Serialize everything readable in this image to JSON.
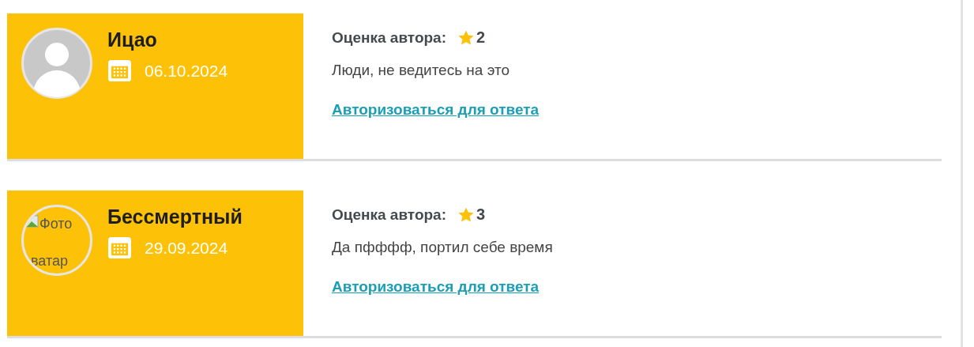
{
  "reviews": [
    {
      "author": "Ицао",
      "date": "06.10.2024",
      "avatar": {
        "kind": "placeholder"
      },
      "rating_label": "Оценка автора:",
      "rating": "2",
      "text": "Люди, не ведитесь на это",
      "reply_link": "Авторизоваться для ответа"
    },
    {
      "author": "Бессмертный",
      "date": "29.09.2024",
      "avatar": {
        "kind": "broken",
        "alt_lines": [
          "Фото",
          "ватар"
        ]
      },
      "rating_label": "Оценка автора:",
      "rating": "3",
      "text": "Да пфффф, портил себе время",
      "reply_link": "Авторизоваться для ответа"
    }
  ]
}
